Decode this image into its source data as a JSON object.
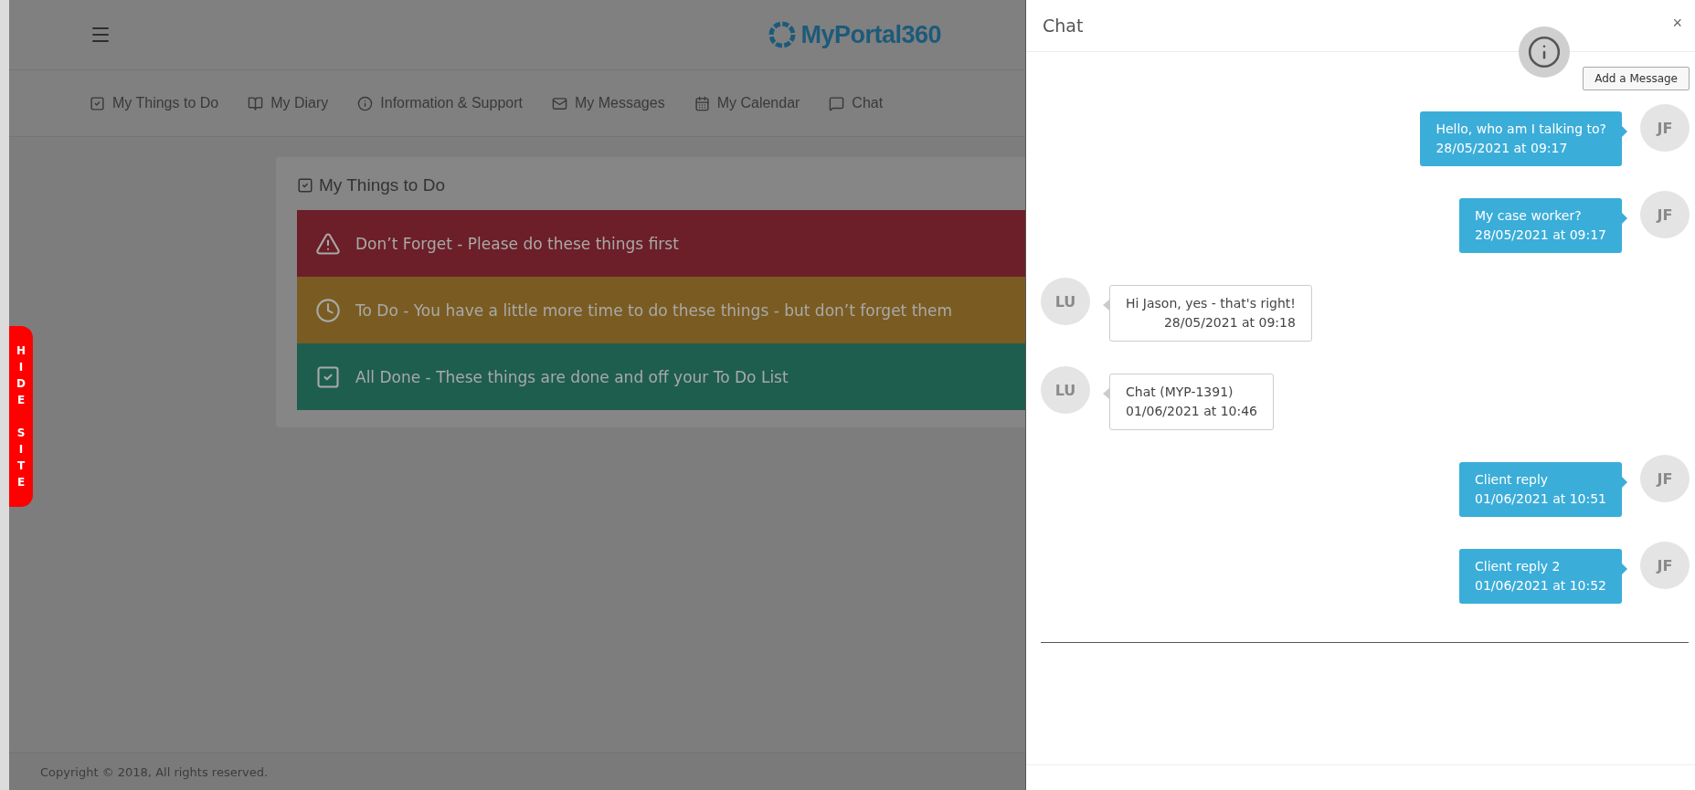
{
  "header": {
    "logo": "MyPortal360"
  },
  "nav": [
    {
      "label": "My Things to Do"
    },
    {
      "label": "My Diary"
    },
    {
      "label": "Information & Support"
    },
    {
      "label": "My Messages"
    },
    {
      "label": "My Calendar"
    },
    {
      "label": "Chat"
    }
  ],
  "todo": {
    "title": "My Things to Do",
    "rows": [
      {
        "label": "Don’t Forget - Please do these things first",
        "color": "#6c1f28"
      },
      {
        "label": "To Do - You have a little more time to do these things - but don’t forget them",
        "color": "#7a5c22"
      },
      {
        "label": "All Done - These things are done and off your To Do List",
        "color": "#1e5e4f"
      }
    ]
  },
  "side_tab": {
    "label": "HIDE SITE"
  },
  "footer": {
    "copyright": "Copyright © 2018, All rights reserved."
  },
  "chat": {
    "title": "Chat",
    "close": "×",
    "add_button": "Add a Message",
    "messages": [
      {
        "kind": "sent",
        "initials": "JF",
        "text": "Hello, who am I talking to?",
        "time": "28/05/2021 at 09:17"
      },
      {
        "kind": "sent",
        "initials": "JF",
        "text": "My case worker?",
        "time": "28/05/2021 at 09:17"
      },
      {
        "kind": "received",
        "initials": "LU",
        "text": "Hi Jason, yes - that's right!",
        "time": "28/05/2021 at 09:18"
      },
      {
        "kind": "received",
        "initials": "LU",
        "text": "Chat (MYP-1391)",
        "time": "01/06/2021 at 10:46"
      },
      {
        "kind": "sent",
        "initials": "JF",
        "text": "Client reply",
        "time": "01/06/2021 at 10:51"
      },
      {
        "kind": "sent",
        "initials": "JF",
        "text": "Client reply 2",
        "time": "01/06/2021 at 10:52"
      }
    ]
  }
}
